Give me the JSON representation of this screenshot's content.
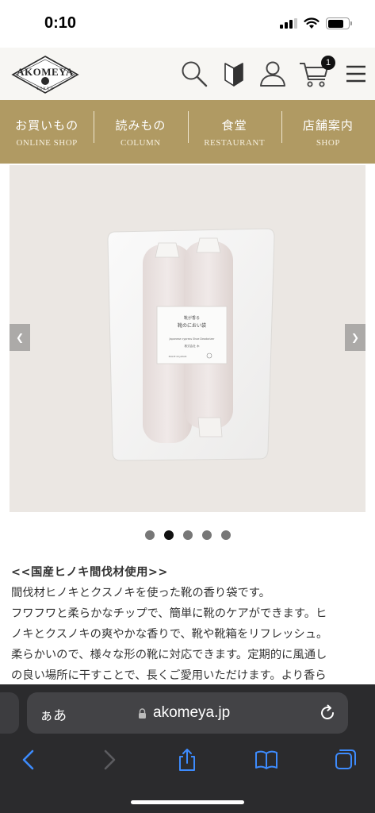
{
  "status": {
    "time": "0:10"
  },
  "header": {
    "logo_text": "AKOMEYA",
    "logo_sub": "TOKYO",
    "cart_count": "1"
  },
  "nav": [
    {
      "jp": "お買いもの",
      "en": "ONLINE SHOP"
    },
    {
      "jp": "読みもの",
      "en": "COLUMN"
    },
    {
      "jp": "食堂",
      "en": "RESTAURANT"
    },
    {
      "jp": "店舗案内",
      "en": "SHOP"
    }
  ],
  "gallery": {
    "label_line1": "靴が香る",
    "label_line2": "靴のにおい袋",
    "label_en": "Japanese cypress Shoe Deodorizer",
    "label_maker": "株式会社 木",
    "label_origin": "MADE IN JAPAN",
    "slide_count": 5,
    "active_slide": 2,
    "prev_icon": "chevron-left-icon",
    "next_icon": "chevron-right-icon"
  },
  "description": {
    "heading": "<<国産ヒノキ間伐材使用>>",
    "lines": [
      "間伐材ヒノキとクスノキを使った靴の香り袋です。",
      "フワフワと柔らかなチップで、簡単に靴のケアができます。ヒ",
      "ノキとクスノキの爽やかな香りで、靴や靴箱をリフレッシュ。",
      "柔らかいので、様々な形の靴に対応できます。定期的に風通し",
      "の良い場所に干すことで、長くご愛用いただけます。より香ら"
    ]
  },
  "browser": {
    "aa_label": "ぁあ",
    "url": "akomeya.jp"
  },
  "colors": {
    "nav_gold": "#b09a63",
    "header_bg": "#f7f6f3",
    "browser_bg": "#2b2b2d"
  }
}
